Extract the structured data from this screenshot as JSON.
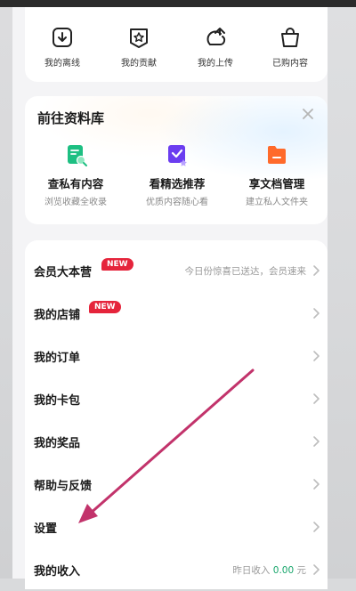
{
  "quick_actions": [
    {
      "label": "我的离线",
      "icon": "download-box-icon"
    },
    {
      "label": "我的贡献",
      "icon": "star-badge-icon"
    },
    {
      "label": "我的上传",
      "icon": "upload-cloud-icon"
    },
    {
      "label": "已购内容",
      "icon": "shopping-bag-icon"
    }
  ],
  "library": {
    "title": "前往资料库",
    "items": [
      {
        "name": "查私有内容",
        "sub": "浏览收藏全收录",
        "icon": "private-docs-icon",
        "color": "#1dbf82"
      },
      {
        "name": "看精选推荐",
        "sub": "优质内容随心看",
        "icon": "curated-check-icon",
        "color": "#6b3df0"
      },
      {
        "name": "享文档管理",
        "sub": "建立私人文件夹",
        "icon": "folder-icon",
        "color": "#ff6a2b"
      }
    ]
  },
  "menu": [
    {
      "label": "会员大本营",
      "badge": "NEW",
      "hint": "今日份惊喜已送达，会员速来"
    },
    {
      "label": "我的店铺",
      "badge": "NEW"
    },
    {
      "label": "我的订单"
    },
    {
      "label": "我的卡包"
    },
    {
      "label": "我的奖品"
    },
    {
      "label": "帮助与反馈"
    },
    {
      "label": "设置"
    },
    {
      "label": "我的收入",
      "hint_prefix": "昨日收入",
      "hint_value": "0.00",
      "hint_suffix": "元"
    }
  ],
  "colors": {
    "badge": "#e5243b",
    "income": "#16a56a",
    "annotation_arrow": "#c2336b"
  }
}
